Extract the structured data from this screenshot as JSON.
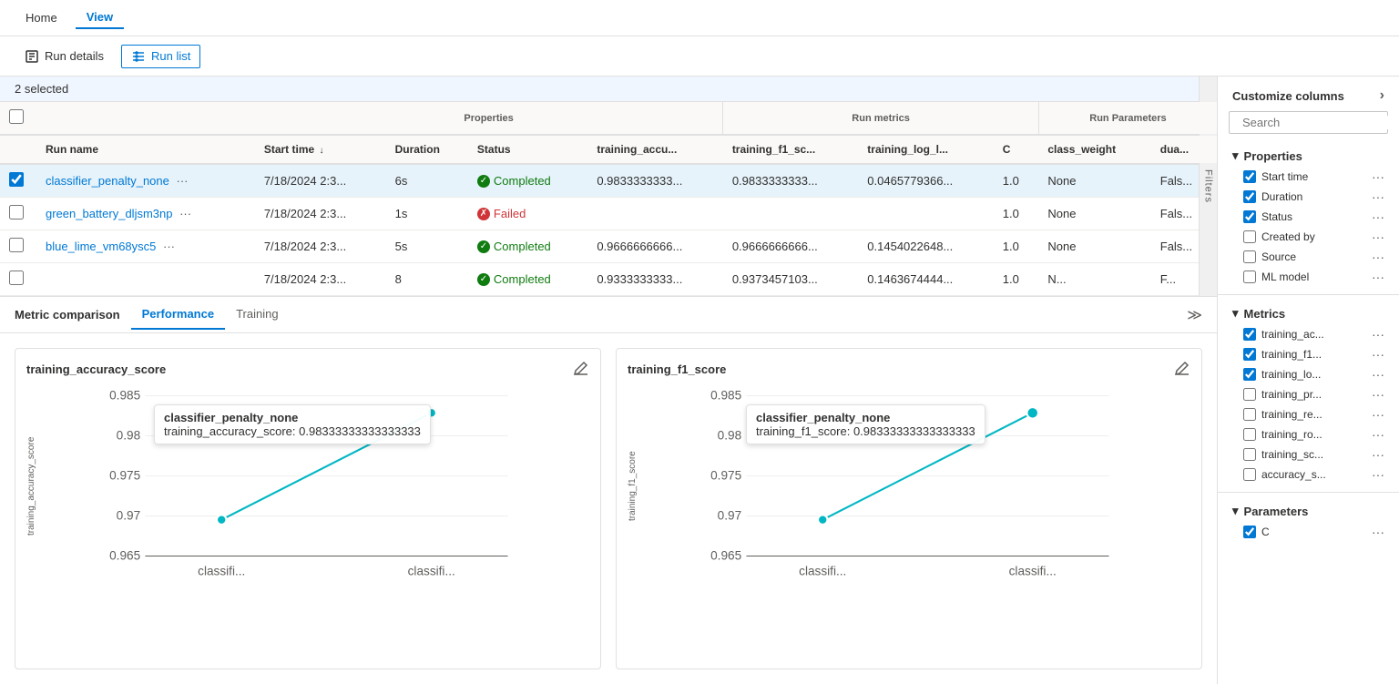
{
  "topNav": {
    "items": [
      {
        "label": "Home",
        "active": false
      },
      {
        "label": "View",
        "active": true
      }
    ]
  },
  "toolbar": {
    "runDetailsLabel": "Run details",
    "runListLabel": "Run list"
  },
  "table": {
    "selectionText": "2 selected",
    "groupHeaders": [
      {
        "label": "Properties",
        "cols": 4
      },
      {
        "label": "Run metrics",
        "cols": 3
      },
      {
        "label": "Run Parameters",
        "cols": 3
      }
    ],
    "columns": [
      "Run name",
      "Start time ↓",
      "Duration",
      "Status",
      "training_accu...",
      "training_f1_sc...",
      "training_log_l...",
      "C",
      "class_weight",
      "dua..."
    ],
    "rows": [
      {
        "checked": true,
        "runName": "classifier_penalty_none",
        "startTime": "7/18/2024 2:3...",
        "duration": "6s",
        "status": "Completed",
        "statusType": "completed",
        "trainingAccu": "0.9833333333...",
        "trainingF1": "0.9833333333...",
        "trainingLog": "0.0465779366...",
        "c": "1.0",
        "classWeight": "None",
        "dual": "Fals..."
      },
      {
        "checked": false,
        "runName": "green_battery_dljsm3np",
        "startTime": "7/18/2024 2:3...",
        "duration": "1s",
        "status": "Failed",
        "statusType": "failed",
        "trainingAccu": "",
        "trainingF1": "",
        "trainingLog": "",
        "c": "1.0",
        "classWeight": "None",
        "dual": "Fals..."
      },
      {
        "checked": false,
        "runName": "blue_lime_vm68ysc5",
        "startTime": "7/18/2024 2:3...",
        "duration": "5s",
        "status": "Completed",
        "statusType": "completed",
        "trainingAccu": "0.9666666666...",
        "trainingF1": "0.9666666666...",
        "trainingLog": "0.1454022648...",
        "c": "1.0",
        "classWeight": "None",
        "dual": "Fals..."
      },
      {
        "checked": false,
        "runName": "",
        "startTime": "7/18/2024 2:3...",
        "duration": "8",
        "status": "Completed",
        "statusType": "completed",
        "trainingAccu": "0.9333333333...",
        "trainingF1": "0.9373457103...",
        "trainingLog": "0.1463674444...",
        "c": "1.0",
        "classWeight": "N...",
        "dual": "F..."
      }
    ]
  },
  "metricComparison": {
    "title": "Metric comparison",
    "tabs": [
      "Performance",
      "Training"
    ],
    "activeTab": "Performance"
  },
  "charts": [
    {
      "title": "training_accuracy_score",
      "yLabel": "training_accuracy_score",
      "xLabels": [
        "classifi...",
        "classifi..."
      ],
      "yValues": [
        0.965,
        0.97,
        0.975,
        0.98,
        0.985
      ],
      "points": [
        {
          "x": 0.15,
          "y": 0.75,
          "value": 0.9666,
          "run": "blue_lime"
        },
        {
          "x": 0.85,
          "y": 0.15,
          "value": 0.9833,
          "run": "classifier_penalty_none"
        }
      ],
      "tooltip": {
        "title": "classifier_penalty_none",
        "detail": "training_accuracy_score: 0.98333333333333333"
      }
    },
    {
      "title": "training_f1_score",
      "yLabel": "training_f1_score",
      "xLabels": [
        "classifi...",
        "classifi..."
      ],
      "yValues": [
        0.965,
        0.97,
        0.975,
        0.98,
        0.985
      ],
      "points": [
        {
          "x": 0.15,
          "y": 0.75,
          "value": 0.9666,
          "run": "blue_lime"
        },
        {
          "x": 0.85,
          "y": 0.15,
          "value": 0.9833,
          "run": "classifier_penalty_none"
        }
      ],
      "tooltip": {
        "title": "classifier_penalty_none",
        "detail": "training_f1_score: 0.98333333333333333"
      }
    }
  ],
  "sidebar": {
    "title": "Customize columns",
    "searchPlaceholder": "Search",
    "sections": [
      {
        "label": "Properties",
        "items": [
          {
            "label": "Start time",
            "checked": true
          },
          {
            "label": "Duration",
            "checked": true
          },
          {
            "label": "Status",
            "checked": true
          },
          {
            "label": "Created by",
            "checked": false
          },
          {
            "label": "Source",
            "checked": false
          },
          {
            "label": "ML model",
            "checked": false
          }
        ]
      },
      {
        "label": "Metrics",
        "items": [
          {
            "label": "training_ac...",
            "checked": true
          },
          {
            "label": "training_f1...",
            "checked": true
          },
          {
            "label": "training_lo...",
            "checked": true
          },
          {
            "label": "training_pr...",
            "checked": false
          },
          {
            "label": "training_re...",
            "checked": false
          },
          {
            "label": "training_ro...",
            "checked": false
          },
          {
            "label": "training_sc...",
            "checked": false
          },
          {
            "label": "accuracy_s...",
            "checked": false
          }
        ]
      },
      {
        "label": "Parameters",
        "items": [
          {
            "label": "C",
            "checked": true
          }
        ]
      }
    ]
  }
}
